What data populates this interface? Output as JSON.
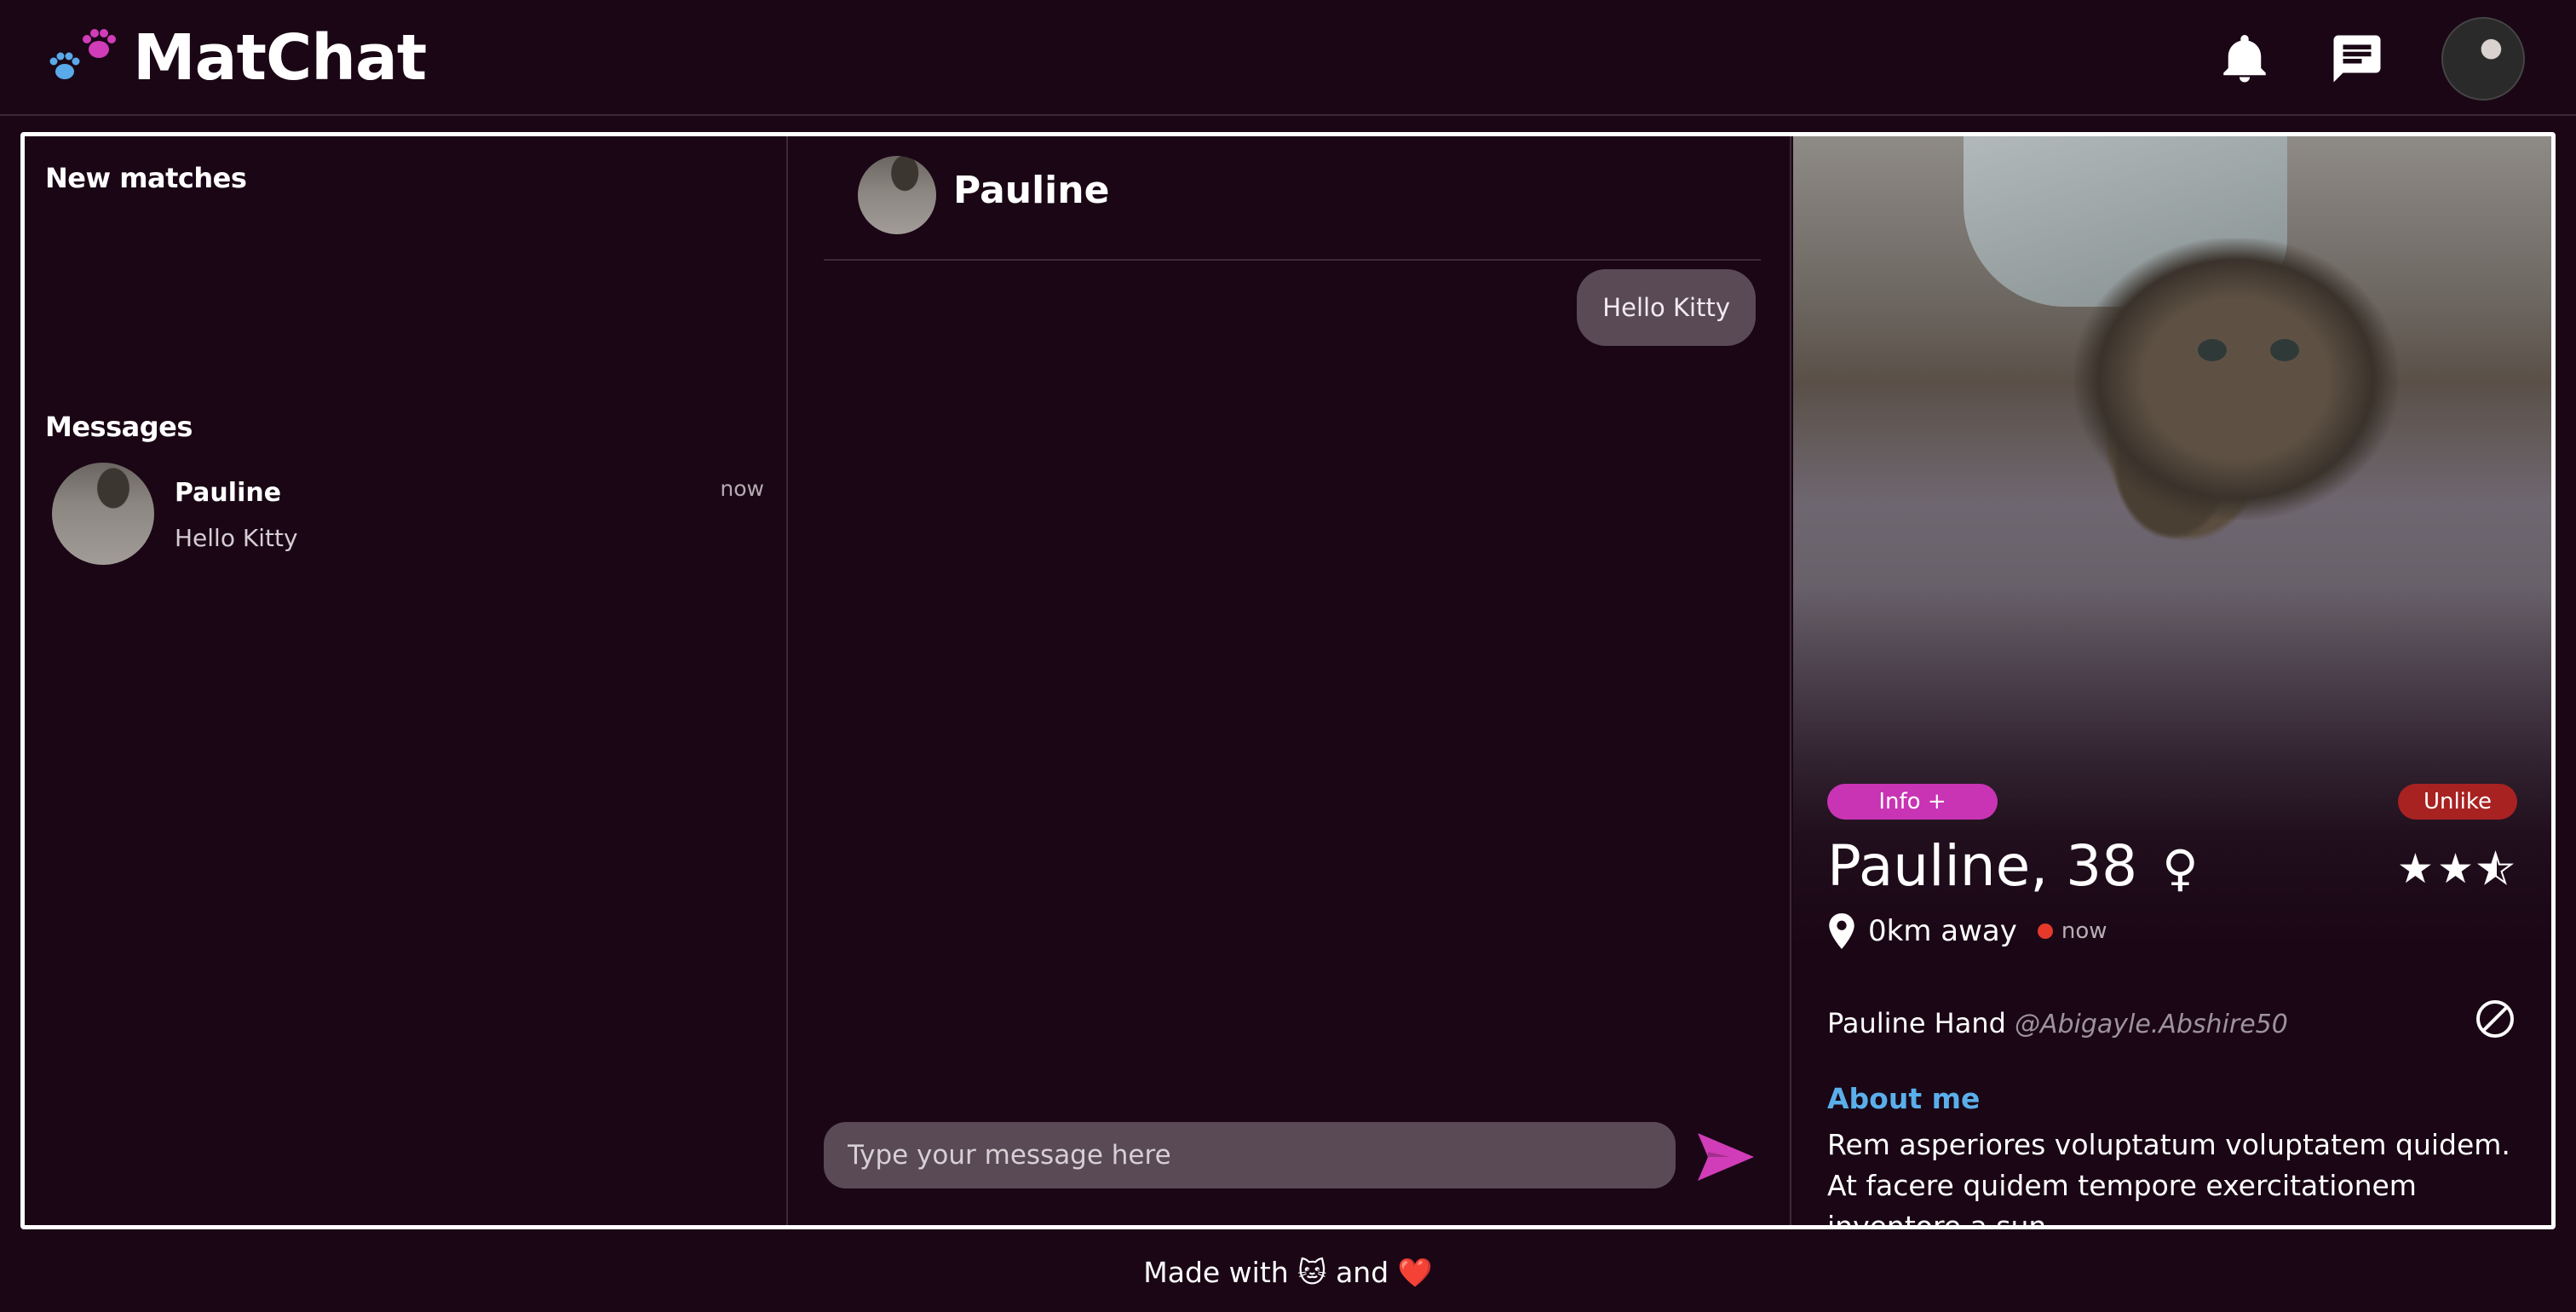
{
  "header": {
    "app_name": "MatChat",
    "icons": [
      "paw-icon",
      "bell-icon",
      "chat-icon",
      "user-avatar"
    ]
  },
  "left": {
    "new_matches_title": "New matches",
    "messages_title": "Messages",
    "conversations": [
      {
        "name": "Pauline",
        "last_message": "Hello Kitty",
        "time": "now"
      }
    ]
  },
  "chat": {
    "contact_name": "Pauline",
    "messages": [
      {
        "text": "Hello Kitty",
        "from": "me"
      }
    ],
    "input_placeholder": "Type your message here"
  },
  "profile": {
    "info_button": "Info +",
    "unlike_button": "Unlike",
    "name_age": "Pauline, 38",
    "gender_symbol": "♀",
    "rating": 2.5,
    "rating_max": 3,
    "distance": "0km away",
    "online_status": "now",
    "full_name": "Pauline Hand",
    "username": "@Abigayle.Abshire50",
    "about_title": "About me",
    "about_text": "Rem asperiores voluptatum voluptatem quidem. At facere quidem tempore exercitationem inventore a sun"
  },
  "footer": {
    "text": "Made with 🐱 and ❤️"
  },
  "colors": {
    "background": "#1a0615",
    "accent_pink": "#c834b4",
    "unlike_red": "#a82222",
    "about_blue": "#5aaeea",
    "bubble": "#5a4a55",
    "online_dot": "#e53a2b"
  }
}
